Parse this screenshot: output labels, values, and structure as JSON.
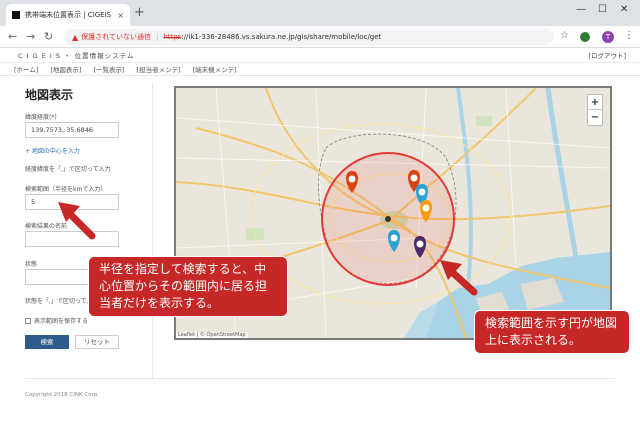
{
  "browser": {
    "tab_title": "携帯端末位置表示 | CIGEIS",
    "tab_close": "×",
    "new_tab": "+",
    "window_controls": [
      "—",
      "☐",
      "✕"
    ],
    "security_label": "保護されていない通信",
    "url_scheme": "https",
    "url_rest": "://ik1-336-28486.vs.sakura.ne.jp/gis/share/mobile/loc/get",
    "avatar_initial": "T"
  },
  "app": {
    "name": "C I G E I S ・ 位置情報システム",
    "logout": "[ログアウト]",
    "nav": [
      "[ホーム]",
      "[地図表示]",
      "[一覧表示]",
      "[担当者メンテ]",
      "[端末機メンテ]"
    ]
  },
  "panel": {
    "title": "地図表示",
    "latlng_label": "緯度経度(*)",
    "latlng_value": "139.7573, 35.6846",
    "center_link": "+ 地図の中心を入力",
    "latlng_hint": "経度緯度を「,」で区切って入力",
    "radius_label": "検索範囲（半径をkmで入力）",
    "radius_value": "5",
    "result_label": "検索結果の名前",
    "result_value": "",
    "status_label": "状態",
    "status_value": "",
    "status_hint": "状態を「,」で区切って入力",
    "save_range_label": "表示範囲を保存する",
    "search_button": "検索",
    "reset_button": "リセット"
  },
  "map": {
    "zoom_in": "+",
    "zoom_out": "−",
    "attribution": "Leaflet | © OpenStreetMap"
  },
  "callouts": {
    "left": "半径を指定して検索すると、中心位置からその範囲内に居る担当者だけを表示する。",
    "right": "検索範囲を示す円が地図上に表示される。"
  },
  "footer": {
    "copyright": "Copyright 2018 CINK Corp."
  },
  "colors": {
    "callout": "#c62828",
    "search_circle": "#e53935",
    "marker_red": "#d84315",
    "marker_blue": "#29a3d6",
    "marker_orange": "#f39c12",
    "marker_purple": "#4a2b6b",
    "button_primary": "#2e5c8a"
  }
}
